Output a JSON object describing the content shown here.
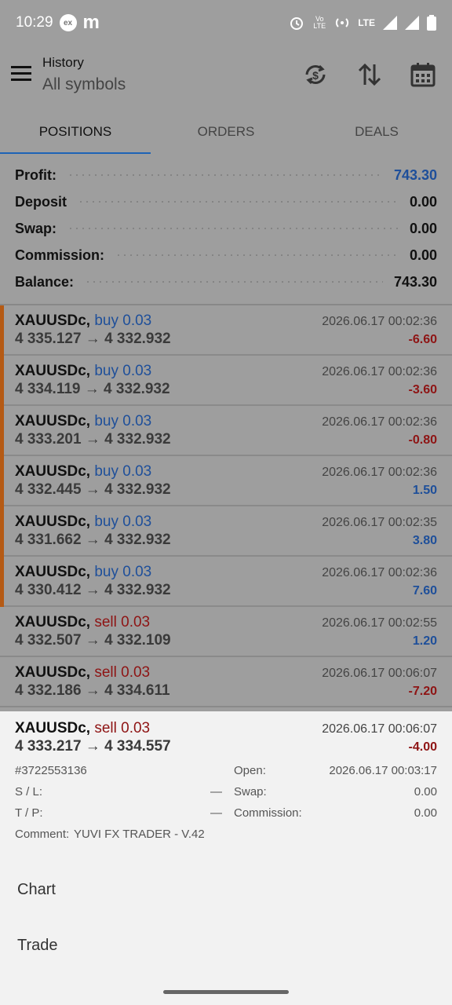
{
  "status_bar": {
    "time": "10:29",
    "badge": "ex",
    "app_letter": "m",
    "volte": "Vo LTE",
    "lte": "LTE"
  },
  "toolbar": {
    "title": "History",
    "subtitle": "All symbols"
  },
  "tabs": [
    {
      "label": "POSITIONS",
      "active": true
    },
    {
      "label": "ORDERS",
      "active": false
    },
    {
      "label": "DEALS",
      "active": false
    }
  ],
  "summary": [
    {
      "label": "Profit:",
      "value": "743.30",
      "accent": true
    },
    {
      "label": "Deposit",
      "value": "0.00"
    },
    {
      "label": "Swap:",
      "value": "0.00"
    },
    {
      "label": "Commission:",
      "value": "0.00"
    },
    {
      "label": "Balance:",
      "value": "743.30"
    }
  ],
  "positions": [
    {
      "symbol": "XAUUSDc,",
      "side": "buy 0.03",
      "prices": "4 335.127 → 4 332.932",
      "time": "2026.06.17 00:02:36",
      "profit": "-6.60"
    },
    {
      "symbol": "XAUUSDc,",
      "side": "buy 0.03",
      "prices": "4 334.119 → 4 332.932",
      "time": "2026.06.17 00:02:36",
      "profit": "-3.60"
    },
    {
      "symbol": "XAUUSDc,",
      "side": "buy 0.03",
      "prices": "4 333.201 → 4 332.932",
      "time": "2026.06.17 00:02:36",
      "profit": "-0.80"
    },
    {
      "symbol": "XAUUSDc,",
      "side": "buy 0.03",
      "prices": "4 332.445 → 4 332.932",
      "time": "2026.06.17 00:02:36",
      "profit": "1.50"
    },
    {
      "symbol": "XAUUSDc,",
      "side": "buy 0.03",
      "prices": "4 331.662 → 4 332.932",
      "time": "2026.06.17 00:02:35",
      "profit": "3.80"
    },
    {
      "symbol": "XAUUSDc,",
      "side": "buy 0.03",
      "prices": "4 330.412 → 4 332.932",
      "time": "2026.06.17 00:02:36",
      "profit": "7.60"
    },
    {
      "symbol": "XAUUSDc,",
      "side": "sell 0.03",
      "prices": "4 332.507 → 4 332.109",
      "time": "2026.06.17 00:02:55",
      "profit": "1.20"
    },
    {
      "symbol": "XAUUSDc,",
      "side": "sell 0.03",
      "prices": "4 332.186 → 4 334.611",
      "time": "2026.06.17 00:06:07",
      "profit": "-7.20"
    }
  ],
  "selected": {
    "symbol": "XAUUSDc,",
    "side": "sell 0.03",
    "prices": "4 333.217 → 4 334.557",
    "time": "2026.06.17 00:06:07",
    "profit": "-4.00",
    "ticket": "#3722553136",
    "sl_label": "S / L:",
    "sl_value": "—",
    "tp_label": "T / P:",
    "tp_value": "—",
    "open_label": "Open:",
    "open_value": "2026.06.17 00:03:17",
    "swap_label": "Swap:",
    "swap_value": "0.00",
    "commission_label": "Commission:",
    "commission_value": "0.00",
    "comment_label": "Comment:",
    "comment_value": "YUVI FX TRADER - V.42"
  },
  "actions": {
    "chart": "Chart",
    "trade": "Trade"
  },
  "colors": {
    "accent_blue": "#1e4f9a",
    "loss_red": "#8e1414",
    "buy_marker": "#b55a14",
    "tab_indicator": "#1e63b6"
  }
}
